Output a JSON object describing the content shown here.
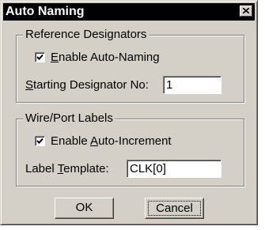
{
  "window": {
    "title": "Auto Naming"
  },
  "reference_group": {
    "legend": "Reference Designators",
    "enable_checkbox": {
      "checked": true,
      "label_mnemonic": "E",
      "label_rest": "nable Auto-Naming"
    },
    "start_field": {
      "label_mnemonic": "S",
      "label_rest": "tarting Designator No:",
      "value": "1"
    }
  },
  "wire_group": {
    "legend": "Wire/Port Labels",
    "enable_checkbox": {
      "checked": true,
      "label_pre": "Enable ",
      "label_mnemonic": "A",
      "label_rest": "uto-Increment"
    },
    "template_field": {
      "label_pre": "Label ",
      "label_mnemonic": "T",
      "label_rest": "emplate:",
      "value": "CLK[0]"
    }
  },
  "buttons": {
    "ok": "OK",
    "cancel": "Cancel"
  },
  "icons": {
    "close": "close-icon",
    "check": "checkmark-icon"
  }
}
